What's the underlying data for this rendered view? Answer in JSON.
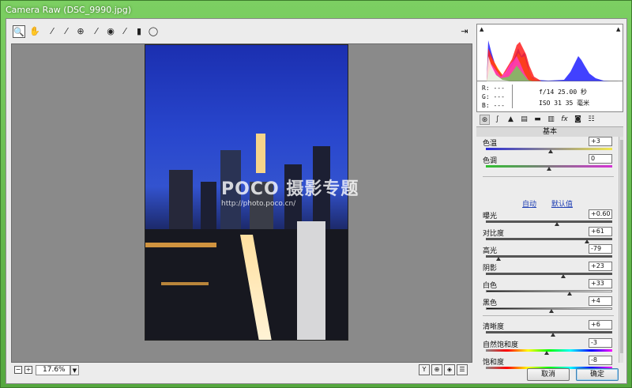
{
  "window": {
    "title": "Camera Raw (DSC_9990.jpg)"
  },
  "toolbar": {
    "tools": [
      {
        "name": "zoom-tool",
        "icon": "magnifier-icon",
        "glyph": "🔍"
      },
      {
        "name": "hand-tool",
        "icon": "hand-icon",
        "glyph": "✋"
      },
      {
        "name": "white-balance-tool",
        "icon": "eyedropper-icon",
        "glyph": "⁄"
      },
      {
        "name": "color-sampler-tool",
        "icon": "color-sampler-icon",
        "glyph": "⁄"
      },
      {
        "name": "targeted-adjustment-tool",
        "icon": "targeted-adjustment-icon",
        "glyph": "⊕"
      },
      {
        "name": "spot-removal-tool",
        "icon": "spot-removal-icon",
        "glyph": "⁄"
      },
      {
        "name": "red-eye-tool",
        "icon": "eye-icon",
        "glyph": "◉"
      },
      {
        "name": "adjustment-brush-tool",
        "icon": "brush-icon",
        "glyph": "⁄"
      },
      {
        "name": "graduated-filter-tool",
        "icon": "graduated-filter-icon",
        "glyph": "▮"
      },
      {
        "name": "radial-filter-tool",
        "icon": "radial-filter-icon",
        "glyph": "◯"
      }
    ],
    "export_glyph": "⇥"
  },
  "canvas": {
    "watermark_logo": "POCO 摄影专题",
    "watermark_url": "http://photo.poco.cn/"
  },
  "bottombar": {
    "zoom_out": "−",
    "zoom_in": "+",
    "zoom": "17.6%",
    "zoom_dropdown": "▼",
    "view_buttons": [
      "Y",
      "⊕",
      "◈",
      "☰"
    ]
  },
  "info": {
    "r": "R:  ---",
    "g": "G:  ---",
    "b": "B:  ---",
    "exposure": "f/14  25.00 秒",
    "iso": "ISO 31  35 毫米"
  },
  "histogram": {
    "clip_shadow": "▲",
    "clip_highlight": "▲"
  },
  "tabs": {
    "icons": [
      {
        "name": "basic-tab-icon",
        "glyph": "⊛"
      },
      {
        "name": "tone-curve-tab-icon",
        "glyph": "∫"
      },
      {
        "name": "detail-tab-icon",
        "glyph": "▲"
      },
      {
        "name": "hsl-tab-icon",
        "glyph": "▤"
      },
      {
        "name": "split-toning-tab-icon",
        "glyph": "▬"
      },
      {
        "name": "lens-corrections-tab-icon",
        "glyph": "▥"
      },
      {
        "name": "effects-tab-icon",
        "glyph": "fx"
      },
      {
        "name": "camera-calibration-tab-icon",
        "glyph": "◙"
      },
      {
        "name": "presets-tab-icon",
        "glyph": "☷"
      }
    ]
  },
  "basic": {
    "section_title": "基本",
    "auto": "自动",
    "default": "默认值",
    "sliders": [
      {
        "key": "temperature",
        "label": "色温",
        "value": "+3",
        "track": "temp",
        "position": 0.51
      },
      {
        "key": "tint",
        "label": "色调",
        "value": "0",
        "track": "tint",
        "position": 0.5
      },
      {
        "key": "exposure",
        "label": "曝光",
        "value": "+0.60",
        "track": "dark",
        "position": 0.56
      },
      {
        "key": "contrast",
        "label": "对比度",
        "value": "+61",
        "track": "dark",
        "position": 0.8
      },
      {
        "key": "highlights",
        "label": "高光",
        "value": "-79",
        "track": "dark",
        "position": 0.1
      },
      {
        "key": "shadows",
        "label": "阴影",
        "value": "+23",
        "track": "dark",
        "position": 0.61
      },
      {
        "key": "whites",
        "label": "白色",
        "value": "+33",
        "track": "gray",
        "position": 0.66
      },
      {
        "key": "blacks",
        "label": "黑色",
        "value": "+4",
        "track": "gray",
        "position": 0.52
      },
      {
        "key": "clarity",
        "label": "清晰度",
        "value": "+6",
        "track": "dark",
        "position": 0.53
      },
      {
        "key": "vibrance",
        "label": "自然饱和度",
        "value": "-3",
        "track": "sat",
        "position": 0.48
      },
      {
        "key": "saturation",
        "label": "饱和度",
        "value": "-8",
        "track": "sat",
        "position": 0.46
      }
    ]
  },
  "buttons": {
    "cancel": "取消",
    "ok": "确定"
  }
}
